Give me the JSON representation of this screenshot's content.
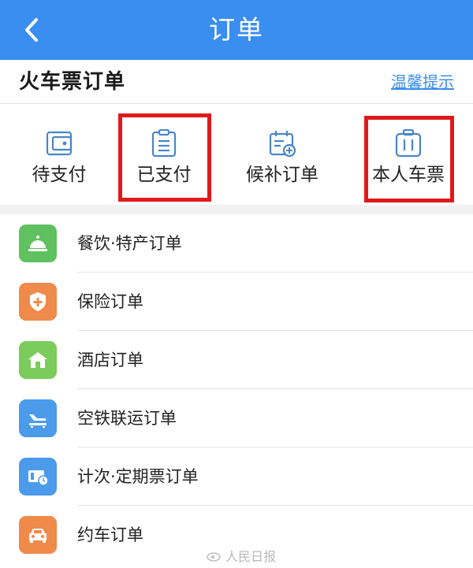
{
  "nav": {
    "title": "订单"
  },
  "section": {
    "title": "火车票订单",
    "tip_link": "温馨提示"
  },
  "quick_actions": [
    {
      "label": "待支付",
      "icon": "wallet-icon"
    },
    {
      "label": "已支付",
      "icon": "clipboard-icon"
    },
    {
      "label": "候补订单",
      "icon": "calendar-add-icon"
    },
    {
      "label": "本人车票",
      "icon": "luggage-icon"
    }
  ],
  "list": [
    {
      "label": "餐饮·特产订单",
      "icon": "dining-bell-icon",
      "color": "#5fc160"
    },
    {
      "label": "保险订单",
      "icon": "shield-cross-icon",
      "color": "#f08a4b"
    },
    {
      "label": "酒店订单",
      "icon": "house-icon",
      "color": "#7ccc5c"
    },
    {
      "label": "空铁联运订单",
      "icon": "plane-train-icon",
      "color": "#4b9bea"
    },
    {
      "label": "计次·定期票订单",
      "icon": "ticket-clock-icon",
      "color": "#4b9bea"
    },
    {
      "label": "约车订单",
      "icon": "car-icon",
      "color": "#f08a4b"
    }
  ],
  "watermark": "人民日报",
  "colors": {
    "primary": "#3a8ef0",
    "highlight": "#e01a1a",
    "icon_outline": "#4a86c8"
  }
}
